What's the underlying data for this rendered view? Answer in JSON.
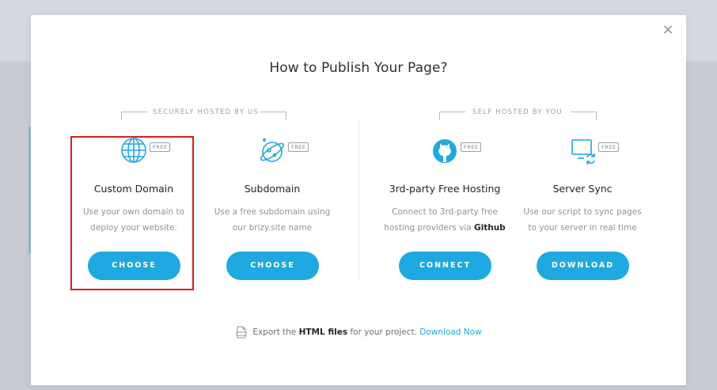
{
  "modal": {
    "title": "How to Publish Your Page?",
    "close_glyph": "×"
  },
  "sections": {
    "hosted": "SECURELY HOSTED BY US",
    "self": "SELF HOSTED BY YOU"
  },
  "badge_label": "FREE",
  "cards": [
    {
      "name": "Custom Domain",
      "desc_line1": "Use your own domain to",
      "desc_line2": "deploy your website.",
      "button": "CHOOSE",
      "icon": "globe-icon"
    },
    {
      "name": "Subdomain",
      "desc_line1": "Use a free subdomain using",
      "desc_line2": "our brizy.site name",
      "button": "CHOOSE",
      "icon": "planet-icon"
    },
    {
      "name": "3rd-party Free Hosting",
      "desc_line1": "Connect to 3rd-party free",
      "desc_line2_prefix": "hosting providers via ",
      "desc_line2_bold": "Github",
      "button": "CONNECT",
      "icon": "github-icon"
    },
    {
      "name": "Server Sync",
      "desc_line1": "Use our script to sync pages",
      "desc_line2": "to your server in real time",
      "button": "DOWNLOAD",
      "icon": "server-sync-icon"
    }
  ],
  "export": {
    "prefix": "Export the ",
    "bold": "HTML files",
    "middle": " for your project. ",
    "link": "Download Now",
    "icon": "html-file-icon"
  },
  "colors": {
    "accent": "#1ea9e1",
    "highlight": "#e01b1b"
  }
}
